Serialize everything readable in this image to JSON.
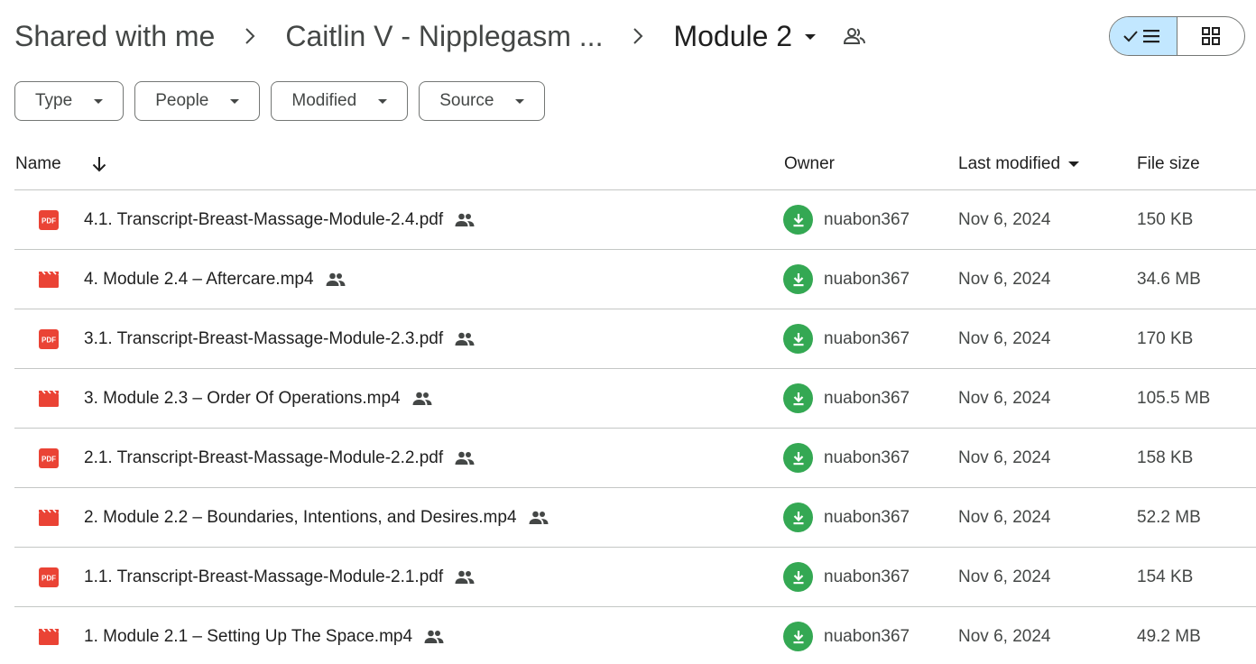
{
  "breadcrumb": {
    "root": "Shared with me",
    "parent": "Caitlin V - Nipplegasm ...",
    "current": "Module 2"
  },
  "filters": [
    {
      "label": "Type"
    },
    {
      "label": "People"
    },
    {
      "label": "Modified"
    },
    {
      "label": "Source"
    }
  ],
  "table": {
    "headers": {
      "name": "Name",
      "owner": "Owner",
      "last_modified": "Last modified",
      "file_size": "File size"
    },
    "rows": [
      {
        "type": "pdf",
        "name": "4.1. Transcript-Breast-Massage-Module-2.4.pdf",
        "owner": "nuabon367",
        "modified": "Nov 6, 2024",
        "size": "150 KB"
      },
      {
        "type": "video",
        "name": "4. Module 2.4 – Aftercare.mp4",
        "owner": "nuabon367",
        "modified": "Nov 6, 2024",
        "size": "34.6 MB"
      },
      {
        "type": "pdf",
        "name": "3.1. Transcript-Breast-Massage-Module-2.3.pdf",
        "owner": "nuabon367",
        "modified": "Nov 6, 2024",
        "size": "170 KB"
      },
      {
        "type": "video",
        "name": "3. Module 2.3 – Order Of Operations.mp4",
        "owner": "nuabon367",
        "modified": "Nov 6, 2024",
        "size": "105.5 MB"
      },
      {
        "type": "pdf",
        "name": "2.1. Transcript-Breast-Massage-Module-2.2.pdf",
        "owner": "nuabon367",
        "modified": "Nov 6, 2024",
        "size": "158 KB"
      },
      {
        "type": "video",
        "name": "2. Module 2.2 – Boundaries, Intentions, and Desires.mp4",
        "owner": "nuabon367",
        "modified": "Nov 6, 2024",
        "size": "52.2 MB"
      },
      {
        "type": "pdf",
        "name": "1.1. Transcript-Breast-Massage-Module-2.1.pdf",
        "owner": "nuabon367",
        "modified": "Nov 6, 2024",
        "size": "154 KB"
      },
      {
        "type": "video",
        "name": "1. Module 2.1 – Setting Up The Space.mp4",
        "owner": "nuabon367",
        "modified": "Nov 6, 2024",
        "size": "49.2 MB"
      }
    ]
  },
  "icons": {
    "pdf": "pdf-file-icon",
    "video": "video-file-icon",
    "shared": "shared-people-icon",
    "owner": "download-avatar-icon"
  },
  "colors": {
    "pdf_red": "#ea4335",
    "avatar_green": "#34a853",
    "selected_toggle": "#c2e7ff"
  }
}
